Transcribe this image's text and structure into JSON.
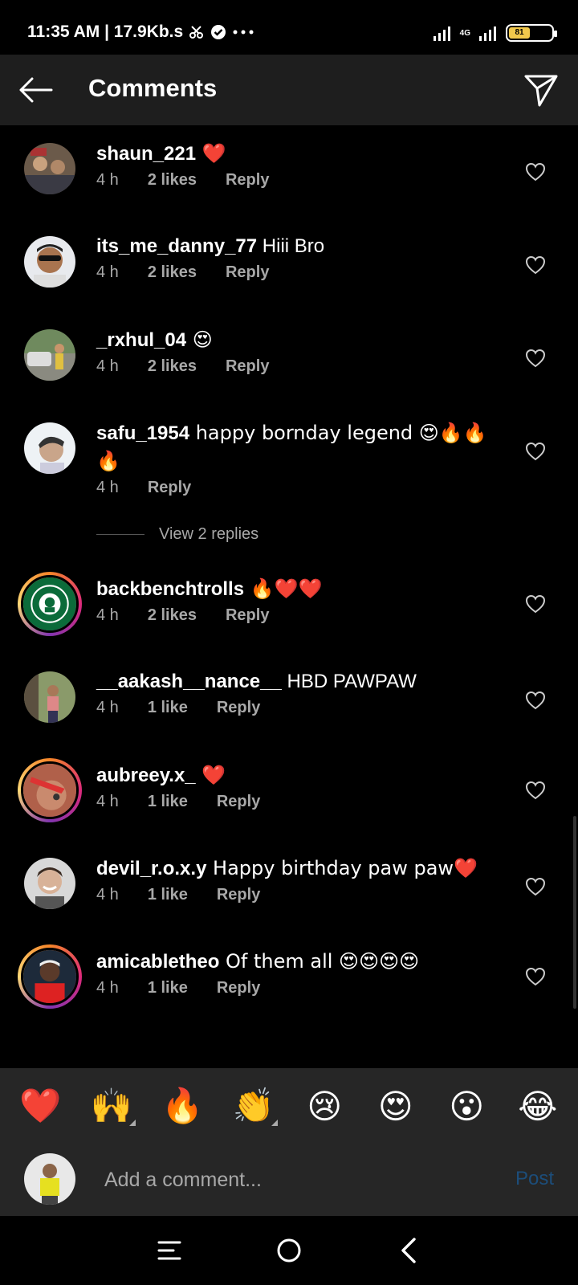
{
  "status_bar": {
    "time": "11:35 AM | 17.9Kb.s",
    "network": "4G",
    "battery": "81"
  },
  "header": {
    "title": "Comments"
  },
  "comments": [
    {
      "username": "shaun_221",
      "text": " ❤️",
      "time": "4 h",
      "likes": "2 likes",
      "reply": "Reply"
    },
    {
      "username": "its_me_danny_77",
      "text": " Hiii Bro",
      "time": "4 h",
      "likes": "2 likes",
      "reply": "Reply"
    },
    {
      "username": "_rxhul_04",
      "text": " 😍",
      "time": "4 h",
      "likes": "2 likes",
      "reply": "Reply"
    },
    {
      "username": "safu_1954",
      "text": " happy bornday legend 😍🔥🔥🔥",
      "time": "4 h",
      "likes": "",
      "reply": "Reply"
    },
    {
      "username": "backbenchtrolls",
      "text": " 🔥❤️❤️",
      "time": "4 h",
      "likes": "2 likes",
      "reply": "Reply"
    },
    {
      "username": "__aakash__nance__",
      "text": " HBD PAWPAW",
      "time": "4 h",
      "likes": "1 like",
      "reply": "Reply"
    },
    {
      "username": "aubreey.x_",
      "text": " ❤️",
      "time": "4 h",
      "likes": "1 like",
      "reply": "Reply"
    },
    {
      "username": "devil_r.o.x.y",
      "text": " Happy birthday paw paw❤️",
      "time": "4 h",
      "likes": "1 like",
      "reply": "Reply"
    },
    {
      "username": "amicabletheo",
      "text": " Of them all 😍😍😍😍",
      "time": "4 h",
      "likes": "1 like",
      "reply": "Reply"
    }
  ],
  "view_replies": "View 2 replies",
  "reactions": [
    "❤️",
    "🙌",
    "🔥",
    "👏",
    "😢",
    "😍",
    "😮",
    "😂"
  ],
  "composer": {
    "placeholder": "Add a comment...",
    "post_label": "Post"
  },
  "colors": {
    "background": "#000000",
    "header": "#1e1e1e",
    "muted": "#a8a8a8",
    "post_disabled": "#1c4d7a"
  }
}
